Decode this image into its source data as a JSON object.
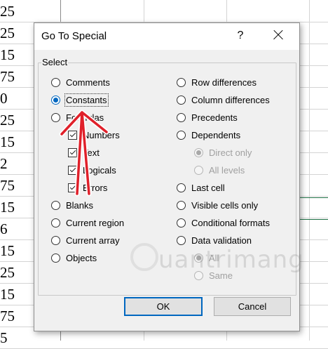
{
  "sheet": {
    "cells": [
      "25",
      "25",
      "15",
      "75",
      "0",
      "25",
      "15",
      "2",
      "75",
      "15",
      "6",
      "15",
      "25",
      "15",
      "75",
      "5"
    ]
  },
  "dialog": {
    "title": "Go To Special",
    "help_label": "?",
    "group_label": "Select",
    "left_options": [
      {
        "label": "Comments",
        "checked": false
      },
      {
        "label": "Constants",
        "checked": true
      },
      {
        "label": "Formulas",
        "checked": false
      }
    ],
    "formula_checks": [
      {
        "label": "Numbers",
        "checked": true
      },
      {
        "label": "Text",
        "checked": true
      },
      {
        "label": "Logicals",
        "checked": true
      },
      {
        "label": "Errors",
        "checked": true
      }
    ],
    "left_options_lower": [
      {
        "label": "Blanks"
      },
      {
        "label": "Current region"
      },
      {
        "label": "Current array"
      },
      {
        "label": "Objects"
      }
    ],
    "right_options": [
      {
        "label": "Row differences"
      },
      {
        "label": "Column differences"
      },
      {
        "label": "Precedents"
      },
      {
        "label": "Dependents"
      }
    ],
    "dependents_sub": [
      {
        "label": "Direct only",
        "checked": true
      },
      {
        "label": "All levels",
        "checked": false
      }
    ],
    "right_options_lower": [
      {
        "label": "Last cell"
      },
      {
        "label": "Visible cells only"
      },
      {
        "label": "Conditional formats"
      },
      {
        "label": "Data validation"
      }
    ],
    "validation_sub": [
      {
        "label": "All",
        "checked": true
      },
      {
        "label": "Same",
        "checked": false
      }
    ],
    "ok_label": "OK",
    "cancel_label": "Cancel"
  },
  "watermark": {
    "text": "uantrimang"
  },
  "colors": {
    "accent": "#0067c0",
    "arrow": "#e0202a",
    "dialog_bg": "#f0f0f0"
  }
}
